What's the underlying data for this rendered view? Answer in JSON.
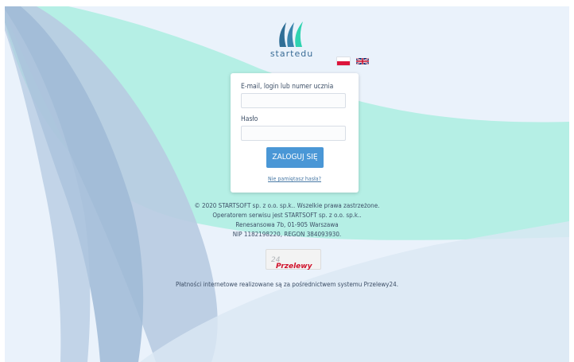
{
  "brand": {
    "name": "startedu"
  },
  "languages": [
    {
      "code": "pl",
      "icon": "flag-pl"
    },
    {
      "code": "en",
      "icon": "flag-gb"
    }
  ],
  "login": {
    "email_label": "E-mail, login lub numer ucznia",
    "email_value": "",
    "password_label": "Hasło",
    "password_value": "",
    "submit_label": "ZALOGUJ SIĘ",
    "forgot_label": "Nie pamiętasz hasła?"
  },
  "footer": {
    "line1": "© 2020 STARTSOFT sp. z o.o. sp.k.. Wszelkie prawa zastrzeżone.",
    "line2": "Operatorem serwisu jest STARTSOFT sp. z o.o. sp.k..",
    "line3": "Renesansowa 7b, 01-905 Warszawa",
    "line4": "NIP 1182198220, REGON 384093930."
  },
  "payment": {
    "logo_text": "Przelewy",
    "logo_suffix": "24",
    "note": "Płatności internetowe realizowane są za pośrednictwem systemu Przelewy24."
  },
  "colors": {
    "accent": "#4a97d6",
    "teal": "#a8ecdf",
    "background": "#eaf2fb"
  }
}
